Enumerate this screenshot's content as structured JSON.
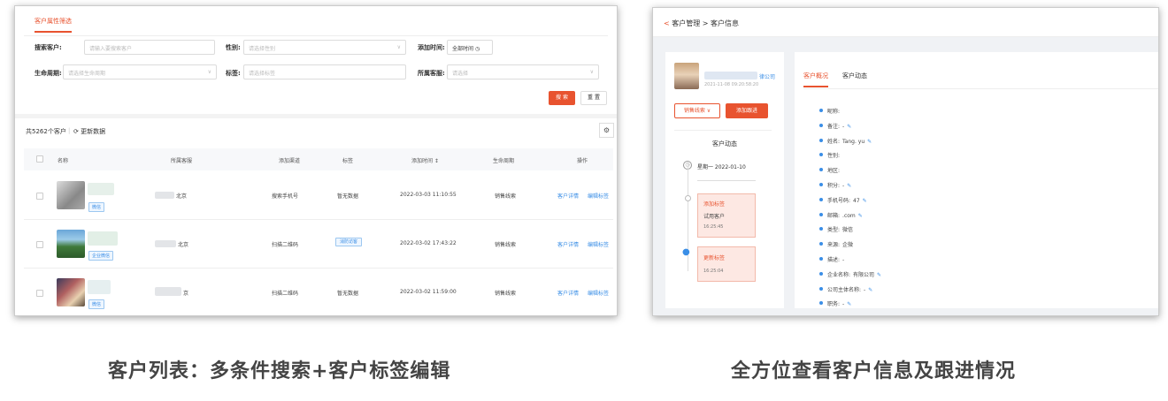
{
  "left": {
    "filter_tab": "客户属性筛选",
    "filters": {
      "search_label": "搜索客户:",
      "search_placeholder": "请输入要搜索客户",
      "gender_label": "性别:",
      "gender_placeholder": "请选择性别",
      "time_label": "添加时间:",
      "time_value": "全部时间",
      "lifecycle_label": "生命周期:",
      "lifecycle_placeholder": "请选择生命周期",
      "tag_label": "标签:",
      "tag_placeholder": "请选择标签",
      "owner_label": "所属客服:",
      "owner_placeholder": "请选择"
    },
    "search_btn": "搜 索",
    "reset_btn": "重 置",
    "count": "共5262个客户",
    "refresh": "更新数据",
    "columns": [
      "名称",
      "所属客服",
      "添加渠道",
      "标签",
      "添加时间 ↕",
      "生命周期",
      "操作"
    ],
    "rows": [
      {
        "badge": "微信",
        "owner": "北京",
        "channel": "搜索手机号",
        "tag": "暂无数据",
        "time": "2022-03-03 11:10:55",
        "lifecycle": "销售线索",
        "op1": "客户详情",
        "op2": "编辑标签"
      },
      {
        "badge": "企业微信",
        "owner": "北京",
        "channel": "扫描二维码",
        "tag": "消防访客",
        "time": "2022-03-02 17:43:22",
        "lifecycle": "销售线索",
        "op1": "客户详情",
        "op2": "编辑标签"
      },
      {
        "badge": "微信",
        "owner": "京",
        "channel": "扫描二维码",
        "tag": "暂无数据",
        "time": "2022-03-02 11:59:00",
        "lifecycle": "销售线索",
        "op1": "客户详情",
        "op2": "编辑标签"
      }
    ]
  },
  "right": {
    "breadcrumb": "客户管理 > 客户信息",
    "company_suffix": "律公司",
    "created": "2021-11-08 09:20:58:20",
    "stage_btn": "销售线索 ∨",
    "follow_btn": "添加跟进",
    "activity_title": "客户动态",
    "date_line": "星期一 2022-01-10",
    "event1_title": "添加标签",
    "event1_body": "试用客户",
    "event1_time": "16:25:45",
    "event2_title": "更新标签",
    "event2_time": "16:25:04",
    "tab_overview": "客户概况",
    "tab_activity": "客户动态",
    "fields": [
      {
        "label": "昵称:",
        "value": "",
        "edit": false
      },
      {
        "label": "备注:",
        "value": "-",
        "edit": true
      },
      {
        "label": "姓名:",
        "value": "Tang. yu",
        "edit": true
      },
      {
        "label": "性别:",
        "value": "",
        "edit": false
      },
      {
        "label": "地区:",
        "value": "",
        "edit": false
      },
      {
        "label": "积分:",
        "value": "-",
        "edit": true
      },
      {
        "label": "手机号码:",
        "value": "47",
        "edit": true
      },
      {
        "label": "邮箱:",
        "value": ".com",
        "edit": true
      },
      {
        "label": "类型:",
        "value": "微信",
        "edit": false
      },
      {
        "label": "来源:",
        "value": "企微",
        "edit": false
      },
      {
        "label": "描述:",
        "value": "-",
        "edit": false
      },
      {
        "label": "企业名称:",
        "value": "有限公司",
        "edit": true
      },
      {
        "label": "公司主体名称:",
        "value": "-",
        "edit": true
      },
      {
        "label": "职务:",
        "value": "-",
        "edit": true
      }
    ]
  },
  "captions": {
    "left": "客户列表：多条件搜索+客户标签编辑",
    "right": "全方位查看客户信息及跟进情况"
  },
  "colors": {
    "accent": "#e8532f",
    "link": "#3a8ee6"
  }
}
